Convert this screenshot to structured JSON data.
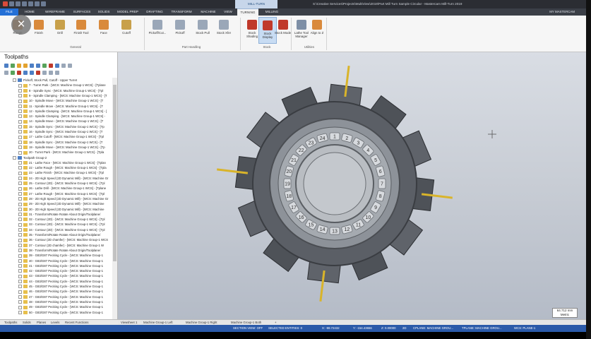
{
  "window": {
    "title": "S:\\Creative Services\\Projects\\MultiView\\2019\\Part Mill Turn Sample Circular - Mastercam Mill-Turn 2019",
    "context_tab": "MILL-TURN"
  },
  "tabs": [
    "FILE",
    "HOME",
    "WIREFRAME",
    "SURFACES",
    "SOLIDS",
    "MODEL PREP",
    "DRAFTING",
    "TRANSFORM",
    "MACHINE",
    "VIEW",
    "TURNING",
    "MILLING"
  ],
  "active_tab": "TURNING",
  "user": "MY MASTERCAM",
  "ribbon": {
    "general_buttons": [
      "Rough",
      "Finish",
      "Drill",
      "Finish Tool",
      "Face",
      "Cutoff"
    ],
    "part_handling_buttons": [
      "Pickoff/Cut...",
      "Pickoff",
      "Stock Pull",
      "Stock Xfer"
    ],
    "stock_buttons": [
      "Stock Shading",
      "Stock Display",
      "Stock Model"
    ],
    "utilities_buttons": [
      "Lathe Tool Manager",
      "Align to Z"
    ],
    "groups": [
      "General",
      "Part Handling",
      "Stock",
      "Utilities"
    ],
    "accent": "#2470d6"
  },
  "panel": {
    "title": "Toolpaths",
    "rows": [
      "Pickoff, Stock Pull, Cutoff - Upper Turret",
      "7 - Turret Park - [WCS: Machine Group-1 WCS] - [Tplane",
      "8 - Spindle Sync - [WCS: Machine Group-1 WCS] - [Tpl",
      "9 - Spindle Clamping - [WCS: Machine Group-1 WCS] - [T",
      "10 - Spindle Move - [WCS: Machine Group-1 WCS] - [T",
      "11 - Spindle Move - [WCS: Machine Group-1 WCS] - [T",
      "12 - Spindle Clamping - [WCS: Machine Group-1 WCS] - [",
      "13 - Spindle Clamping - [WCS: Machine Group-1 WCS] -",
      "14 - Spindle Move - [WCS: Machine Group-1 WCS] - [T",
      "15 - Spindle Sync - [WCS: Machine Group-1 WCS] - [Tp",
      "16 - Spindle Sync - [WCS: Machine Group-1 WCS] - [T",
      "17 - Lathe Cutoff - [WCS: Machine Group-1 WCS] - [Tpl",
      "18 - Spindle Sync - [WCS: Machine Group-1 WCS] - [T",
      "19 - Spindle Move - [WCS: Machine Group-1 WCS] - [Tp",
      "20 - Turret Park - [WCS: Machine Group-1 WCS] - [Tpla",
      "Toolpath Group-2",
      "21 - Lathe Face - [WCS: Machine Group-1 WCS] - [Tplan",
      "22 - Lathe Rough - [WCS: Machine Group-1 WCS] - [Tpla",
      "23 - Lathe Finish - [WCS: Machine Group-1 WCS] - [Tpl",
      "24 - 2D High Speed (2D Dynamic Mill) - [WCS: Machine Gr",
      "25 - Contour (2D) - [WCS: Machine Group-1 WCS] - [Tpl",
      "26 - Lathe Drill - [WCS: Machine Group-1 WCS] - [Tplane",
      "27 - Lathe Rough - [WCS: Machine Group-1 WCS] - [Tpl",
      "28 - 2D High Speed (2D Dynamic Mill) - [WCS: Machine Gr",
      "29 - 2D High Speed (2D Dynamic Mill) - [WCS: Machine",
      "30 - 2D High Speed (2D Dynamic Mill) - [WCS: Machine",
      "31 - Transform/Rotate Rotate About Origin/Toolplane/",
      "32 - Contour (2D) - [WCS: Machine Group-1 WCS] - [Tpl",
      "33 - Contour (2D) - [WCS: Machine Group-1 WCS] - [Tpl",
      "34 - Contour (2D) - [WCS: Machine Group-1 WCS] - [Tpl",
      "35 - Transform/Rotate Rotate About Origin/Toolplane/",
      "36 - Contour (2D chamfer) - [WCS: Machine Group-1 WCS",
      "37 - Contour (2D chamfer) - [WCS: Machine Group-1 W",
      "38 - Transform/Rotate Rotate About Origin/Toolplane/",
      "39 - G83/G87 Pecking Cycle - [WCS: Machine Group-1",
      "40 - G83/G87 Pecking Cycle - [WCS: Machine Group-1",
      "41 - G83/G87 Pecking Cycle - [WCS: Machine Group-1",
      "42 - G83/G87 Pecking Cycle - [WCS: Machine Group-1",
      "43 - G83/G87 Pecking Cycle - [WCS: Machine Group-1",
      "44 - G83/G87 Pecking Cycle - [WCS: Machine Group-1",
      "45 - G83/G87 Pecking Cycle - [WCS: Machine Group-1",
      "46 - G83/G87 Pecking Cycle - [WCS: Machine Group-1",
      "47 - G83/G87 Pecking Cycle - [WCS: Machine Group-1",
      "48 - G83/G87 Pecking Cycle - [WCS: Machine Group-1",
      "49 - G83/G87 Pecking Cycle - [WCS: Machine Group-1",
      "50 - G83/G87 Pecking Cycle - [WCS: Machine Group-1"
    ],
    "bottom_tabs": [
      "Toolpaths",
      "Solids",
      "Planes",
      "Levels",
      "Recent Functions"
    ]
  },
  "viewsheets": [
    "Viewsheet 1",
    "Machine Group-1 Left",
    "Machine Group-1 Right",
    "Machine Group-1 Both",
    "+"
  ],
  "scale": {
    "value": "64.712 mm",
    "unit": "Metric"
  },
  "turret_numbers": [
    "1",
    "2",
    "3",
    "4",
    "5",
    "6",
    "7",
    "8",
    "9",
    "10",
    "11",
    "12",
    "13",
    "14",
    "15",
    "16",
    "17",
    "18",
    "19",
    "20",
    "21",
    "22",
    "23",
    "24"
  ],
  "status": {
    "section_view": "SECTION VIEW: OFF",
    "selected": "SELECTED ENTITIES: 0",
    "x": "X: -98.72432",
    "y": "Y: -154.43656",
    "z": "Z: 0.00000",
    "mode": "2D",
    "cplane": "CPLANE: MACHINE GROU...",
    "tplane": "TPLANE: MACHINE GROU...",
    "wcs": "WCS: PLANE-1"
  }
}
